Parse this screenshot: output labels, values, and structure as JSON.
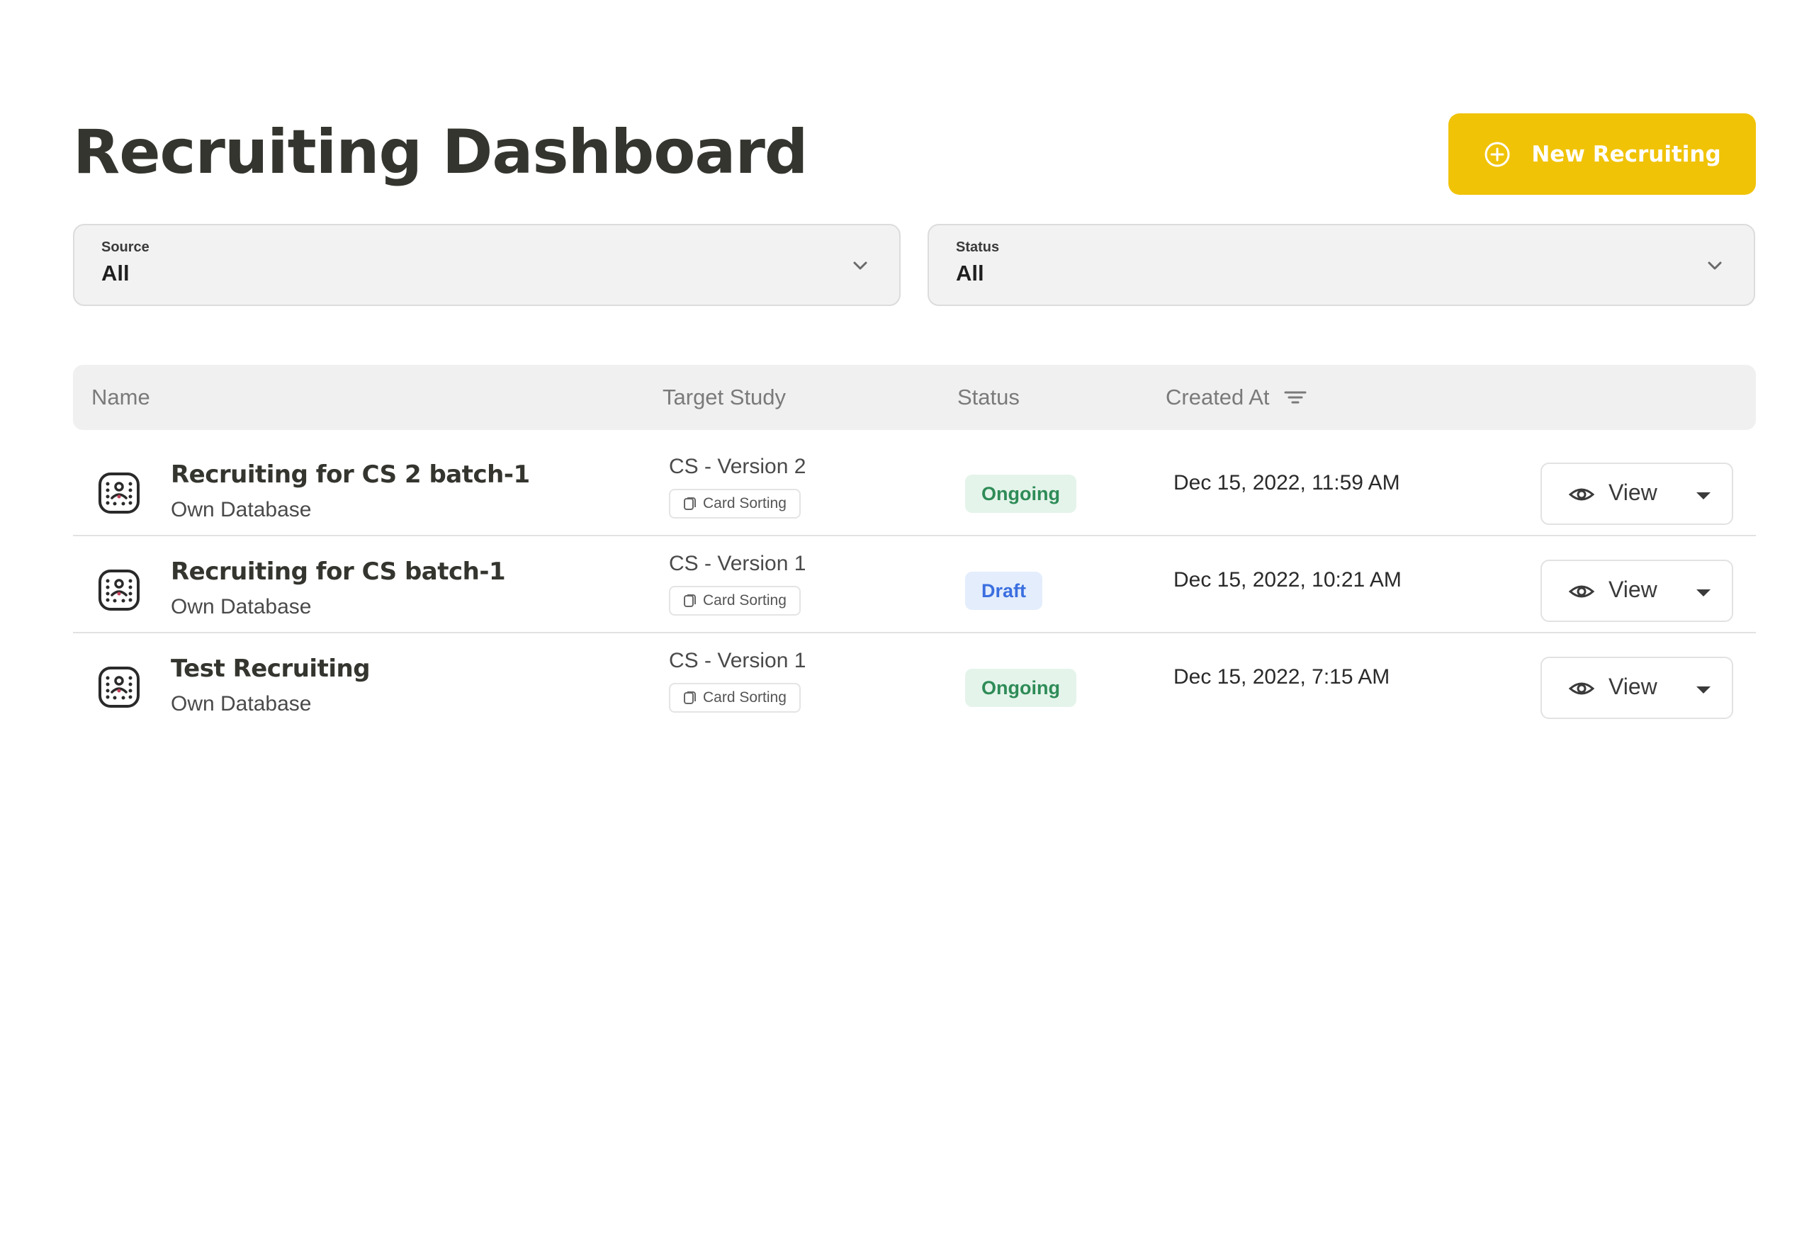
{
  "header": {
    "title": "Recruiting Dashboard",
    "new_button_label": "New Recruiting",
    "new_button_icon": "plus-circle-icon",
    "accent_color": "#f0c307"
  },
  "filters": {
    "source": {
      "label": "Source",
      "value": "All"
    },
    "status": {
      "label": "Status",
      "value": "All"
    }
  },
  "table": {
    "columns": {
      "name": "Name",
      "target_study": "Target Study",
      "status": "Status",
      "created_at": "Created At"
    },
    "rows": [
      {
        "name": "Recruiting for CS 2 batch-1",
        "source": "Own Database",
        "study": "CS - Version 2",
        "study_type": "Card Sorting",
        "status": "Ongoing",
        "created_at": "Dec 15, 2022, 11:59 AM",
        "action": "View"
      },
      {
        "name": "Recruiting for CS batch-1",
        "source": "Own Database",
        "study": "CS - Version 1",
        "study_type": "Card Sorting",
        "status": "Draft",
        "created_at": "Dec 15, 2022, 10:21 AM",
        "action": "View"
      },
      {
        "name": "Test Recruiting",
        "source": "Own Database",
        "study": "CS - Version 1",
        "study_type": "Card Sorting",
        "status": "Ongoing",
        "created_at": "Dec 15, 2022, 7:15 AM",
        "action": "View"
      }
    ]
  },
  "colors": {
    "ongoing_bg": "#e4f4ea",
    "ongoing_text": "#2e8b57",
    "draft_bg": "#e3edfc",
    "draft_text": "#3b6fe0"
  }
}
